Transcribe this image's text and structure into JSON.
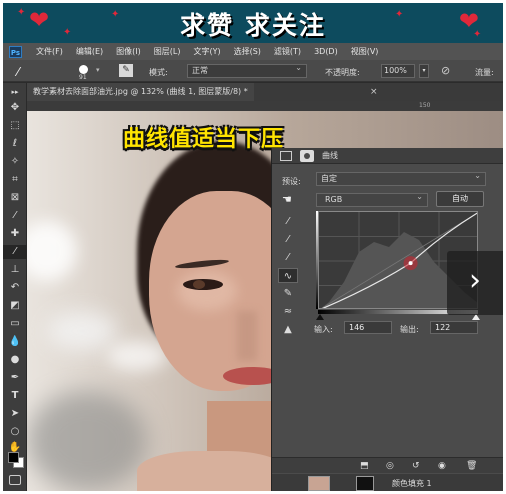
{
  "banner": {
    "title": "求赞 求关注",
    "heart_color": "#e0283a"
  },
  "menubar": {
    "logo": "Ps",
    "items": [
      "文件(F)",
      "编辑(E)",
      "图像(I)",
      "图层(L)",
      "文字(Y)",
      "选择(S)",
      "滤镜(T)",
      "3D(D)",
      "视图(V)"
    ]
  },
  "options": {
    "brush_size": "91",
    "mode_label": "模式:",
    "mode_value": "正常",
    "opacity_label": "不透明度:",
    "opacity_value": "100%",
    "flow_label": "流量:"
  },
  "document": {
    "tab_title": "教学素材去除面部油光.jpg @ 132% (曲线 1, 图层蒙版/8) *",
    "close": "×",
    "ruler_marks": [
      "",
      "",
      "",
      "",
      "",
      "",
      "",
      "150"
    ]
  },
  "caption": "曲线值适当下压",
  "curves_panel": {
    "title": "曲线",
    "preset_label": "预设:",
    "preset_value": "自定",
    "channel_value": "RGB",
    "auto_label": "自动",
    "input_label": "输入:",
    "input_value": "146",
    "output_label": "输出:",
    "output_value": "122",
    "control_point": {
      "input": 146,
      "output": 122
    }
  },
  "layers": {
    "layer_name": "颜色填充 1"
  },
  "icons": {
    "next": "›"
  }
}
